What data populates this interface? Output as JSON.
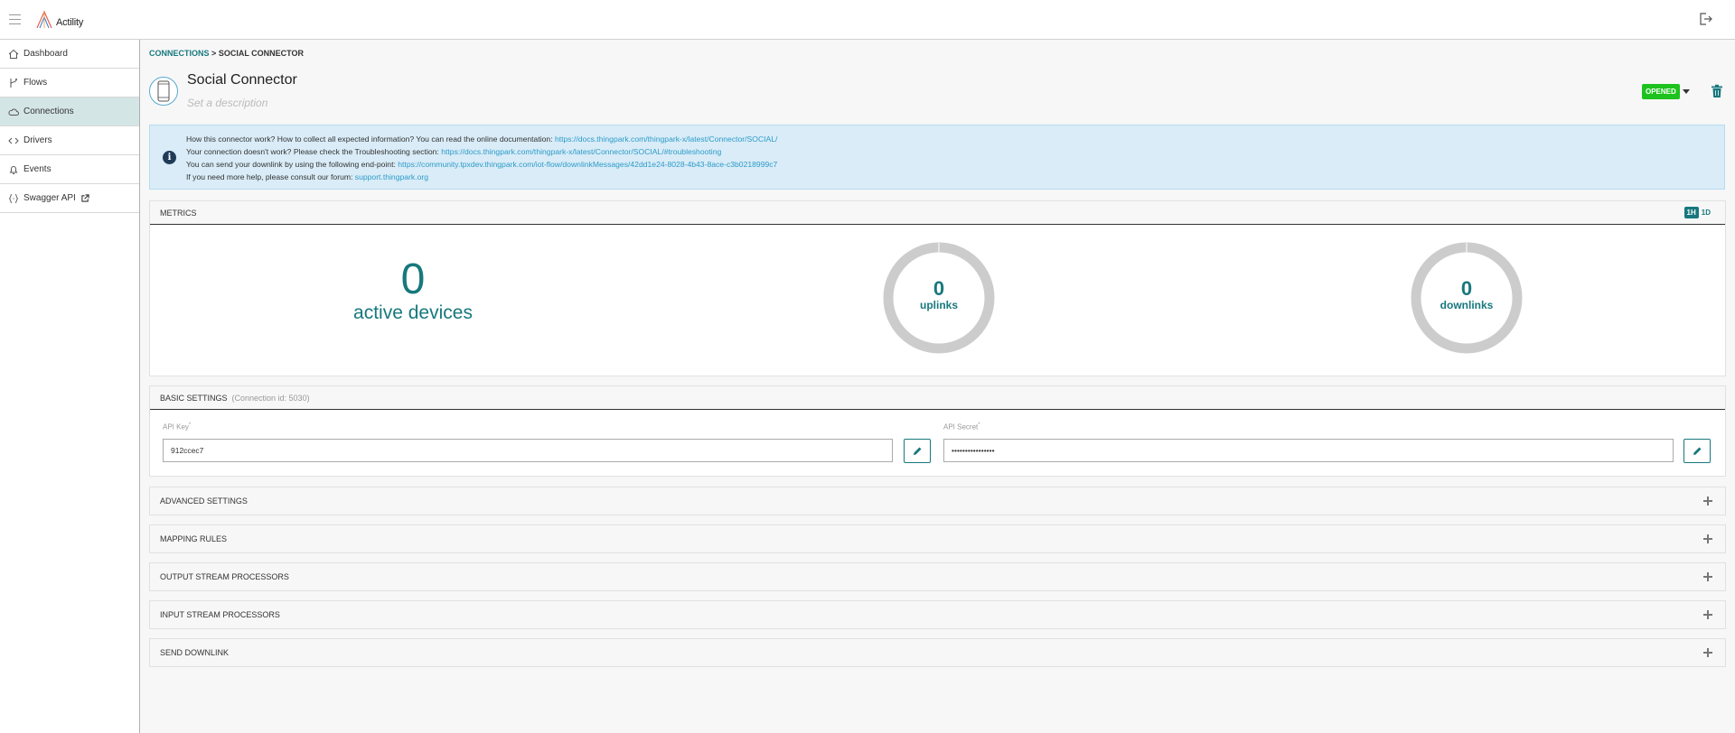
{
  "app": {
    "logo_text": "Actility"
  },
  "sidebar": {
    "items": [
      {
        "label": "Dashboard",
        "icon": "home-icon"
      },
      {
        "label": "Flows",
        "icon": "branch-icon"
      },
      {
        "label": "Connections",
        "icon": "cloud-icon",
        "active": true
      },
      {
        "label": "Drivers",
        "icon": "code-icon"
      },
      {
        "label": "Events",
        "icon": "bell-icon"
      },
      {
        "label": "Swagger API",
        "icon": "braces-icon",
        "external": true
      }
    ]
  },
  "breadcrumb": {
    "parent": "CONNECTIONS",
    "separator": ">",
    "current": "SOCIAL CONNECTOR"
  },
  "header": {
    "title": "Social Connector",
    "description_placeholder": "Set a description",
    "status": "OPENED",
    "status_color": "#1ec21e"
  },
  "info": {
    "line1_text": "How this connector work? How to collect all expected information? You can read the online documentation: ",
    "line1_link": "https://docs.thingpark.com/thingpark-x/latest/Connector/SOCIAL/",
    "line2_text": "Your connection doesn't work? Please check the Troubleshooting section: ",
    "line2_link": "https://docs.thingpark.com/thingpark-x/latest/Connector/SOCIAL/#troubleshooting",
    "line3_text": "You can send your downlink by using the following end-point: ",
    "line3_link": "https://community.tpxdev.thingpark.com/iot-flow/downlinkMessages/42dd1e24-8028-4b43-8ace-c3b0218999c7",
    "line4_text": "If you need more help, please consult our forum: ",
    "line4_link": "support.thingpark.org"
  },
  "metrics": {
    "title": "METRICS",
    "range_1h": "1H",
    "range_1d": "1D",
    "active_range": "1H",
    "active_devices_value": "0",
    "active_devices_label": "active devices",
    "uplinks_value": "0",
    "uplinks_label": "uplinks",
    "downlinks_value": "0",
    "downlinks_label": "downlinks"
  },
  "basic_settings": {
    "title": "BASIC SETTINGS",
    "connection_id": "(Connection id: 5030)",
    "api_key_label": "API Key",
    "api_key_value": "912ccec7",
    "api_secret_label": "API Secret",
    "api_secret_value": "••••••••••••••••",
    "required_mark": "*"
  },
  "sections": [
    {
      "title": "ADVANCED SETTINGS"
    },
    {
      "title": "MAPPING RULES"
    },
    {
      "title": "OUTPUT STREAM PROCESSORS"
    },
    {
      "title": "INPUT STREAM PROCESSORS"
    },
    {
      "title": "SEND DOWNLINK"
    }
  ],
  "colors": {
    "accent": "#17787d",
    "link": "#2d9bc9",
    "info_bg": "#d9ecf7",
    "active_nav": "#d4e5e6"
  }
}
